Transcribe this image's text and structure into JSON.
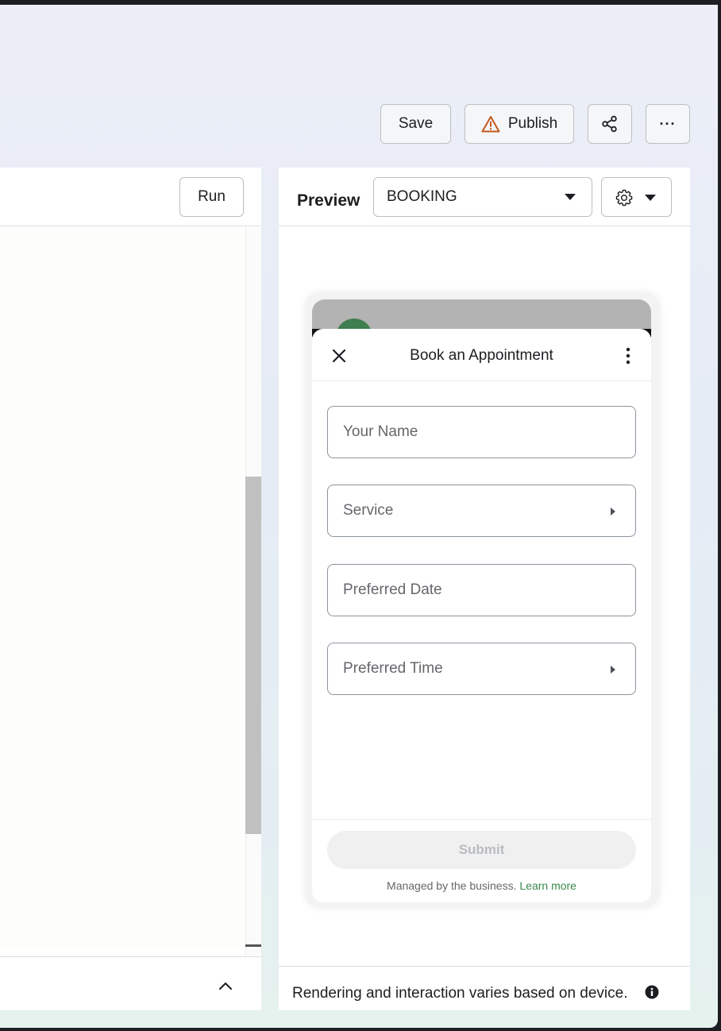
{
  "toolbar": {
    "save_label": "Save",
    "publish_label": "Publish",
    "share_icon": "share-icon",
    "more_label": "···",
    "warning_color": "#c4591b"
  },
  "editor": {
    "run_label": "Run"
  },
  "preview": {
    "title": "Preview",
    "flow_select": "BOOKING",
    "footer_note": "Rendering and interaction varies based on device."
  },
  "form": {
    "title": "Book an Appointment",
    "fields": [
      {
        "placeholder": "Your Name",
        "type": "text"
      },
      {
        "placeholder": "Service",
        "type": "dropdown"
      },
      {
        "placeholder": "Preferred Date",
        "type": "text"
      },
      {
        "placeholder": "Preferred Time",
        "type": "dropdown"
      }
    ],
    "submit_label": "Submit",
    "managed_text": "Managed by the business.",
    "learn_more": "Learn more",
    "accent_color": "#3a8a4e"
  }
}
